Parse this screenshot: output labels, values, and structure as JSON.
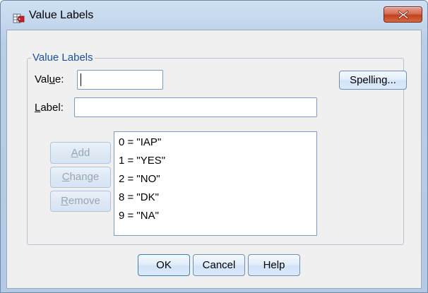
{
  "window": {
    "title": "Value Labels"
  },
  "group": {
    "legend": "Value Labels"
  },
  "value_field": {
    "label_pre": "Val",
    "label_mnemonic": "u",
    "label_post": "e:",
    "value": ""
  },
  "label_field": {
    "label_mnemonic": "L",
    "label_post": "abel:",
    "value": ""
  },
  "buttons": {
    "spelling": "Spelling...",
    "add_mnemonic": "A",
    "add_rest": "dd",
    "change_mnemonic": "C",
    "change_rest": "hange",
    "remove_mnemonic": "R",
    "remove_rest": "emove",
    "ok": "OK",
    "cancel": "Cancel",
    "help": "Help"
  },
  "value_labels": [
    "0 = \"IAP\"",
    "1 = \"YES\"",
    "2 = \"NO\"",
    "8 = \"DK\"",
    "9 = \"NA\""
  ],
  "icons": {
    "app": "value-labels-app-icon",
    "close": "close-icon"
  },
  "colors": {
    "legend": "#1b4f9c",
    "close_button": "#c0431f",
    "disabled_text": "#98a6b4"
  }
}
